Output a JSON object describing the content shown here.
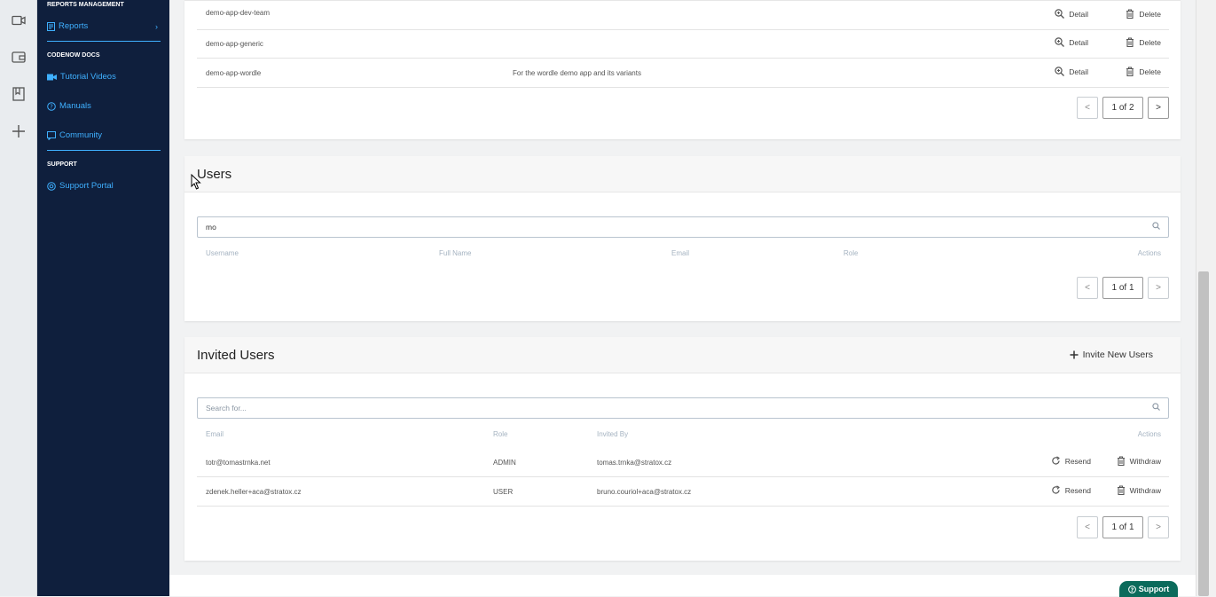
{
  "rail": {
    "icons": [
      "video-icon",
      "wallet-icon",
      "book-icon",
      "plus-icon"
    ]
  },
  "sidebar": {
    "reports_section": "REPORTS MANAGEMENT",
    "reports_label": "Reports",
    "codenow_section": "CODENOW DOCS",
    "tutorial_label": "Tutorial Videos",
    "manuals_label": "Manuals",
    "community_label": "Community",
    "support_section": "SUPPORT",
    "support_portal_label": "Support Portal"
  },
  "apps_table": {
    "rows": [
      {
        "name": "demo-app-dev-team",
        "description": ""
      },
      {
        "name": "demo-app-generic",
        "description": ""
      },
      {
        "name": "demo-app-wordle",
        "description": "For the wordle demo app and its variants"
      }
    ],
    "detail_label": "Detail",
    "delete_label": "Delete",
    "pager": {
      "prev": "<",
      "text": "1 of 2",
      "next": ">"
    }
  },
  "users": {
    "title": "Users",
    "search_value": "mo",
    "columns": [
      "Username",
      "Full Name",
      "Email",
      "Role",
      "Actions"
    ],
    "pager": {
      "prev": "<",
      "text": "1 of 1",
      "next": ">"
    }
  },
  "invited": {
    "title": "Invited Users",
    "invite_label": "Invite New Users",
    "search_placeholder": "Search for...",
    "columns": [
      "Email",
      "Role",
      "Invited By",
      "Actions"
    ],
    "rows": [
      {
        "email": "totr@tomastrnka.net",
        "role": "ADMIN",
        "invited_by": "tomas.trnka@stratox.cz"
      },
      {
        "email": "zdenek.heller+aca@stratox.cz",
        "role": "USER",
        "invited_by": "bruno.couriol+aca@stratox.cz"
      }
    ],
    "resend_label": "Resend",
    "withdraw_label": "Withdraw",
    "pager": {
      "prev": "<",
      "text": "1 of 1",
      "next": ">"
    }
  },
  "support_button": "Support",
  "colors": {
    "sidebar": "#0f1f3d",
    "accent": "#3fb0ff",
    "support": "#0b6b5b"
  }
}
